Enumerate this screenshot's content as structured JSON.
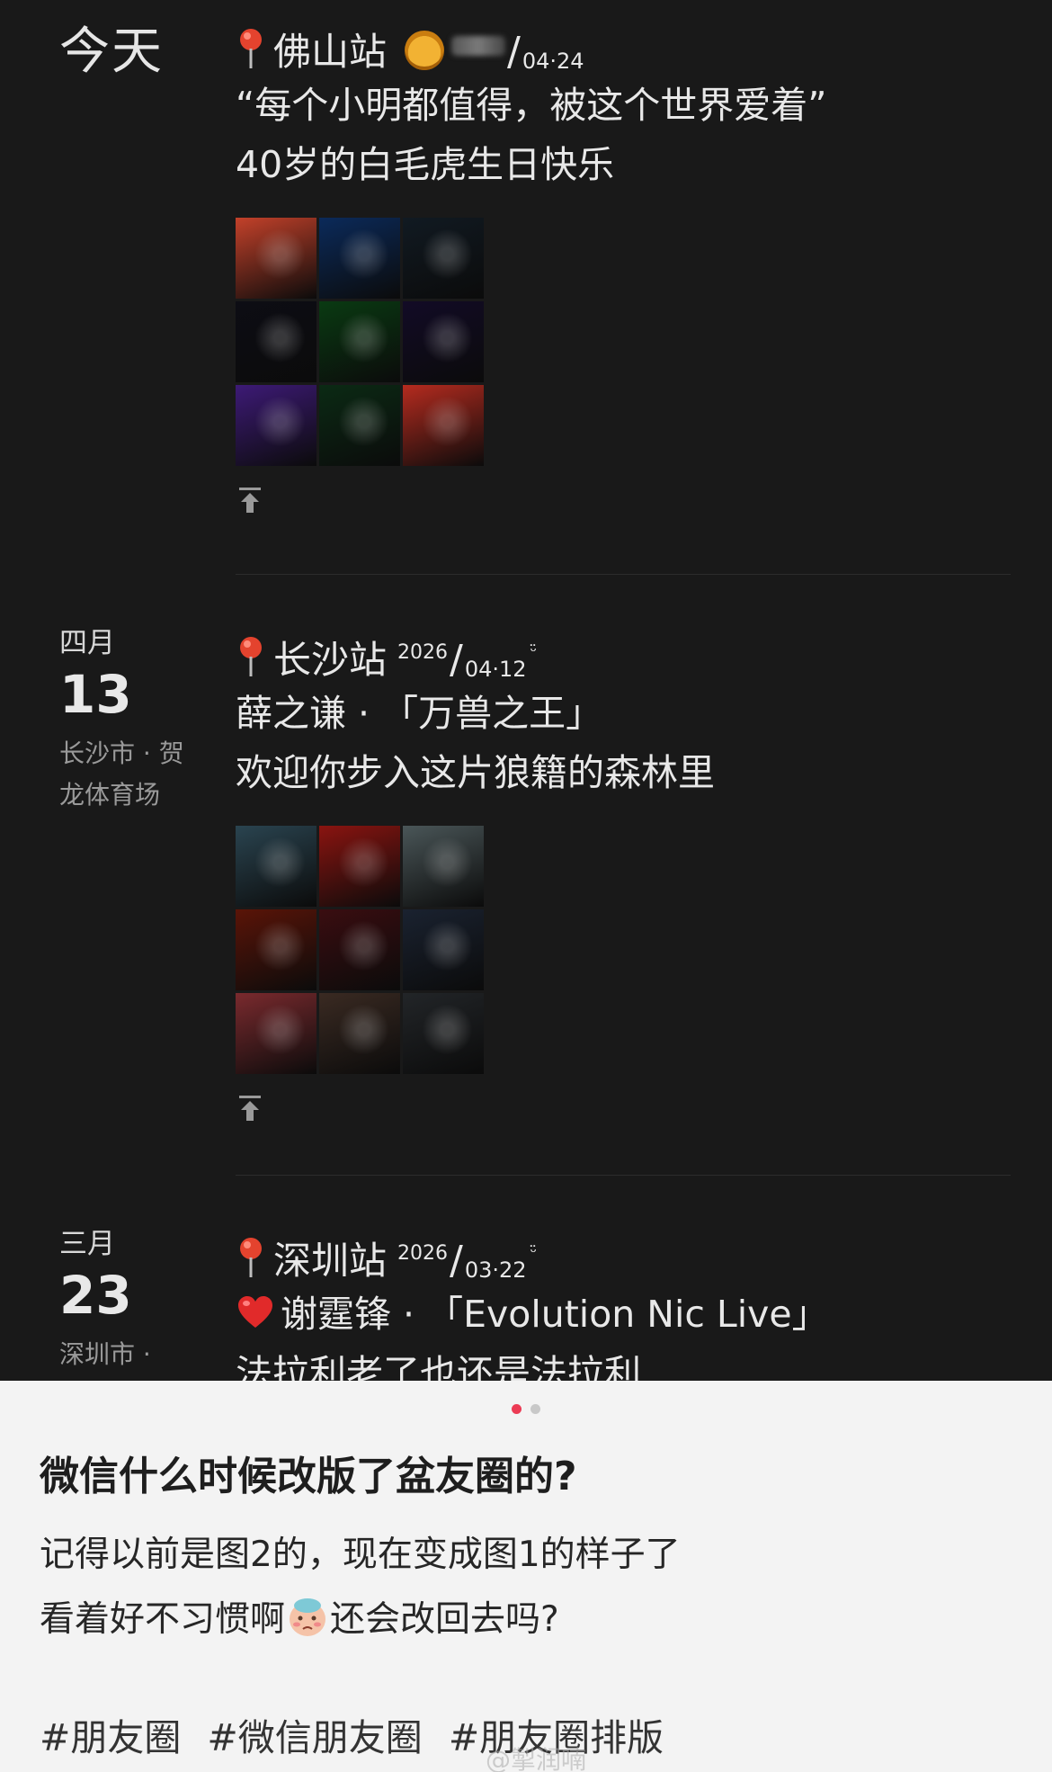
{
  "posts": [
    {
      "date_label": "今天",
      "location": {
        "city_station": "佛山站",
        "date_suffix": "/",
        "mmdd": "04·24"
      },
      "lines": [
        "“每个小明都值得，被这个世界爱着”",
        "40岁的白毛虎生日快乐"
      ],
      "photos": [
        "#c3412a",
        "#0b2a5a",
        "#111a22",
        "#0d0d14",
        "#0a3a12",
        "#120b26",
        "#3d1a76",
        "#0b2a14",
        "#b52b1f"
      ]
    },
    {
      "month": "四月",
      "day": "13",
      "place": "长沙市 · 贺龙体育场",
      "location": {
        "city_station": "长沙站",
        "year": "2026",
        "date_suffix": "/",
        "mmdd": "04·12",
        "smile": "ᵕ̈"
      },
      "lines": [
        "薛之谦 · 「万兽之王」",
        "欢迎你步入这片狼籍的森林里"
      ],
      "photos": [
        "#2a4450",
        "#8a1410",
        "#4a5658",
        "#5a1408",
        "#3a0d10",
        "#1a2230",
        "#7a2a2e",
        "#3a2a22",
        "#222528"
      ]
    },
    {
      "month": "三月",
      "day": "23",
      "place": "深圳市 ·",
      "location": {
        "city_station": "深圳站",
        "year": "2026",
        "date_suffix": "/",
        "mmdd": "03·22",
        "smile": "ᵕ̈"
      },
      "lines": [
        "谢霆锋 · 「Evolution Nic Live」",
        "法拉利老了也还是法拉利"
      ]
    }
  ],
  "panel": {
    "title": "微信什么时候改版了盆友圈的?",
    "body_line1": "记得以前是图2的，现在变成图1的样子了",
    "body_line2a": "看着好不习惯啊",
    "body_line2b": "还会改回去吗?",
    "tags": [
      "#朋友圈",
      "#微信朋友圈",
      "#朋友圈排版"
    ],
    "watermark": "@掣润喃"
  }
}
